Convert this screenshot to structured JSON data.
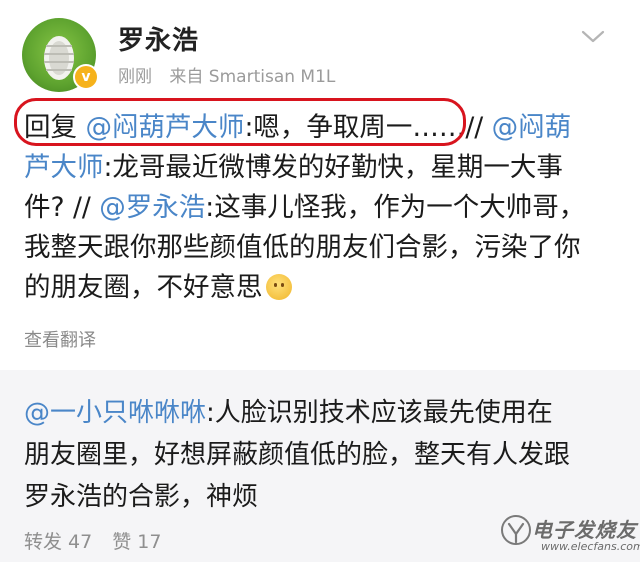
{
  "post": {
    "username": "罗永浩",
    "time": "刚刚",
    "source": "来自 Smartisan M1L",
    "lines": {
      "l1_a": "回复 ",
      "l1_mention": "@闷葫芦大师",
      "l1_b": ":嗯，争取周一……// ",
      "l1_mention2": "@闷葫",
      "l2_mention": "芦大师",
      "l2_b": ":龙哥最近微博发的好勤快，星期一大事",
      "l3_a": "件? // ",
      "l3_mention": "@罗永浩",
      "l3_b": ":这事儿怪我，作为一个大帅哥，",
      "l4": "我整天跟你那些颜值低的朋友们合影，污染了你",
      "l5": "的朋友圈，不好意思"
    },
    "translate_label": "查看翻译"
  },
  "repost": {
    "mention": "@一小只咻咻咻",
    "line1": ":人脸识别技术应该最先使用在",
    "line2": "朋友圈里，好想屏蔽颜值低的脸，整天有人发跟",
    "line3": "罗永浩的合影，神烦",
    "forward_label": "转发 47",
    "like_label": "赞 17"
  },
  "watermark": {
    "text": "电子发烧友",
    "url": "www.elecfans.com"
  },
  "colors": {
    "mention": "#4a86c8",
    "highlight": "#d8141e",
    "verified": "#f6b21b"
  },
  "icons": [
    "chevron-down-icon",
    "verified-badge-icon",
    "emoji-icon"
  ]
}
